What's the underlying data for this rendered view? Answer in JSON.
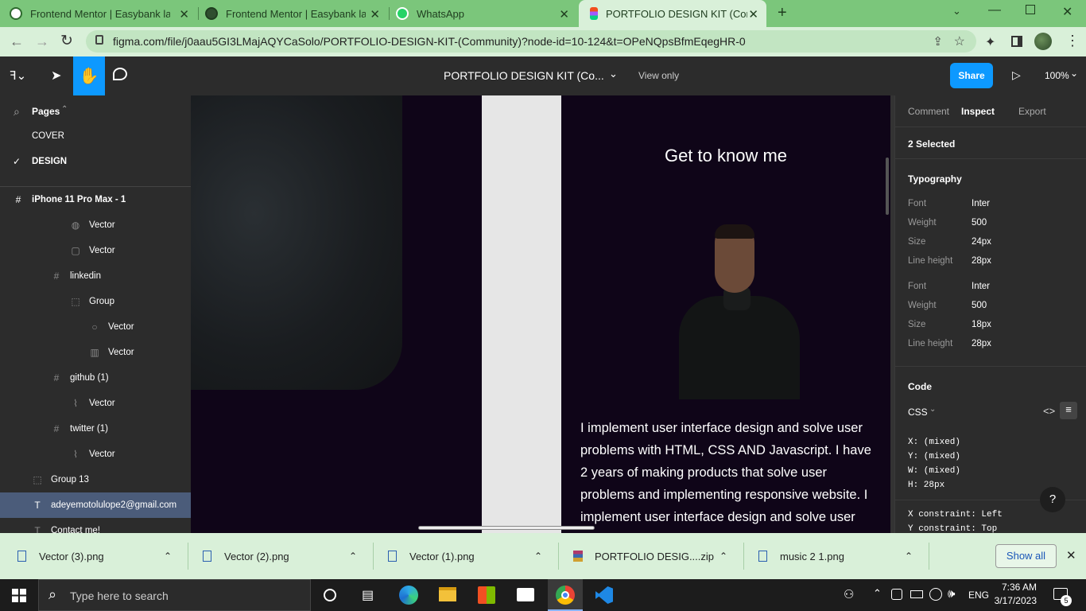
{
  "tabs": [
    {
      "title": "Frontend Mentor | Easybank landi",
      "icon": "globe-icon"
    },
    {
      "title": "Frontend Mentor | Easybank landi",
      "icon": "globe-icon"
    },
    {
      "title": "WhatsApp",
      "icon": "whatsapp-icon"
    },
    {
      "title": "PORTFOLIO DESIGN KIT (Commu",
      "icon": "figma-icon"
    }
  ],
  "new_tab_label": "+",
  "address": {
    "url": "figma.com/file/j0aau5GI3LMajAQYCaSolo/PORTFOLIO-DESIGN-KIT-(Community)?node-id=10-124&t=OPeNQpsBfmEqegHR-0"
  },
  "toolbar": {
    "file_title": "PORTFOLIO DESIGN KIT (Co...",
    "mode": "View only",
    "share": "Share",
    "zoom": "100%"
  },
  "pages": {
    "header": "Pages",
    "items": [
      "COVER",
      "DESIGN"
    ],
    "selected": "DESIGN"
  },
  "layers": [
    {
      "name": "iPhone 11 Pro Max - 1",
      "icon": "frame-icon",
      "bold": true
    },
    {
      "name": "Vector",
      "icon": "vector-icon"
    },
    {
      "name": "Vector",
      "icon": "vector-icon"
    },
    {
      "name": "linkedin",
      "icon": "frame-icon"
    },
    {
      "name": "Group",
      "icon": "group-icon"
    },
    {
      "name": "Vector",
      "icon": "ellipse-icon"
    },
    {
      "name": "Vector",
      "icon": "vector-icon"
    },
    {
      "name": "github (1)",
      "icon": "frame-icon"
    },
    {
      "name": "Vector",
      "icon": "vector-icon"
    },
    {
      "name": "twitter (1)",
      "icon": "frame-icon"
    },
    {
      "name": "Vector",
      "icon": "vector-icon"
    },
    {
      "name": "Group 13",
      "icon": "group-icon"
    },
    {
      "name": "adeyemotolulope2@gmail.com",
      "icon": "text-icon",
      "selected": true
    },
    {
      "name": "Contact me!",
      "icon": "text-icon"
    }
  ],
  "canvas": {
    "heading": "Get to know me",
    "body": "I implement user interface design and solve user problems with HTML, CSS AND Javascript. I have 2 years of making products that solve user problems and implementing responsive website. I implement user interface design and solve user"
  },
  "inspector": {
    "tabs": [
      "Comment",
      "Inspect",
      "Export"
    ],
    "active_tab": "Inspect",
    "selection": "2 Selected",
    "typography_title": "Typography",
    "labels": {
      "font": "Font",
      "weight": "Weight",
      "size": "Size",
      "line_height": "Line height"
    },
    "styles": [
      {
        "font": "Inter",
        "weight": "500",
        "size": "24px",
        "line_height": "28px"
      },
      {
        "font": "Inter",
        "weight": "500",
        "size": "18px",
        "line_height": "28px"
      }
    ],
    "code_title": "Code",
    "code_lang": "CSS",
    "code_lines": [
      "X: (mixed)",
      "Y: (mixed)",
      "W: (mixed)",
      "H: 28px"
    ],
    "constraints": [
      "X constraint: Left",
      "Y constraint: Top"
    ],
    "help": "?"
  },
  "downloads": {
    "items": [
      "Vector (3).png",
      "Vector (2).png",
      "Vector (1).png",
      "PORTFOLIO DESIG....zip",
      "music 2 1.png"
    ],
    "show_all": "Show all"
  },
  "taskbar": {
    "search_placeholder": "Type here to search",
    "language": "ENG",
    "time": "7:36 AM",
    "date": "3/17/2023",
    "notification_count": "5"
  }
}
